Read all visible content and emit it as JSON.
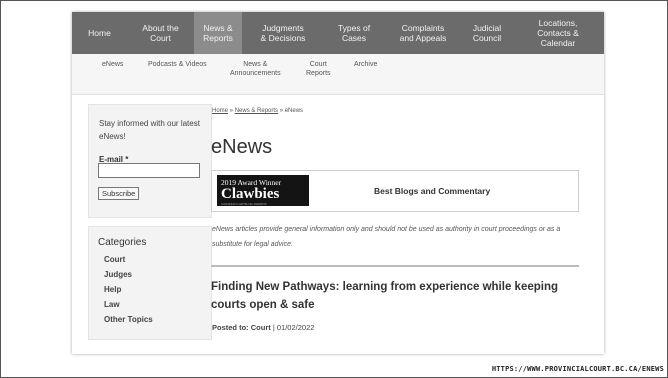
{
  "nav": {
    "items": [
      {
        "label": "Home"
      },
      {
        "label": "About the\nCourt"
      },
      {
        "label": "News &\nReports"
      },
      {
        "label": "Judgments\n& Decisions"
      },
      {
        "label": "Types of\nCases"
      },
      {
        "label": "Complaints\nand Appeals"
      },
      {
        "label": "Judicial\nCouncil"
      },
      {
        "label": "Locations,\nContacts &\nCalendar"
      }
    ],
    "active": "News & Reports"
  },
  "subnav": {
    "items": [
      {
        "label": "eNews"
      },
      {
        "label": "Podcasts & Videos"
      },
      {
        "label": "News &\nAnnouncements"
      },
      {
        "label": "Court\nReports"
      },
      {
        "label": "Archive"
      }
    ]
  },
  "newsletter": {
    "prompt": "Stay informed with our latest eNews!",
    "email_label": "E-mail *",
    "email_value": "",
    "subscribe_label": "Subscribe"
  },
  "categories": {
    "title": "Categories",
    "items": [
      {
        "label": "Court"
      },
      {
        "label": "Judges"
      },
      {
        "label": "Help"
      },
      {
        "label": "Law"
      },
      {
        "label": "Other Topics"
      }
    ]
  },
  "breadcrumb": {
    "home": "Home",
    "sep1": " » ",
    "section": "News & Reports",
    "sep2": " » ",
    "current": "eNews"
  },
  "page_title": "eNews",
  "award": {
    "top": "2019 Award Winner",
    "name": "Clawbies",
    "sub": "CANADIAN LAW BLOG AWARDS",
    "category": "Best Blogs and Commentary"
  },
  "disclaimer": "eNews articles provide general information only and should not be used as authority in court proceedings or as a substitute for legal advice.",
  "article": {
    "title": "Finding New Pathways: learning from experience while keeping courts open & safe",
    "posted_prefix": "Posted to: ",
    "posted_category": "Court",
    "posted_sep": " | ",
    "posted_date": "01/02/2022"
  },
  "source_url": "HTTPS://WWW.PROVINCIALCOURT.BC.CA/ENEWS",
  "colors": {
    "nav_bg": "#6b6b6b",
    "nav_active": "#8c8c8c",
    "subnav_bg": "#f6f6f6",
    "sidebar_bg": "#f3f3f3"
  }
}
